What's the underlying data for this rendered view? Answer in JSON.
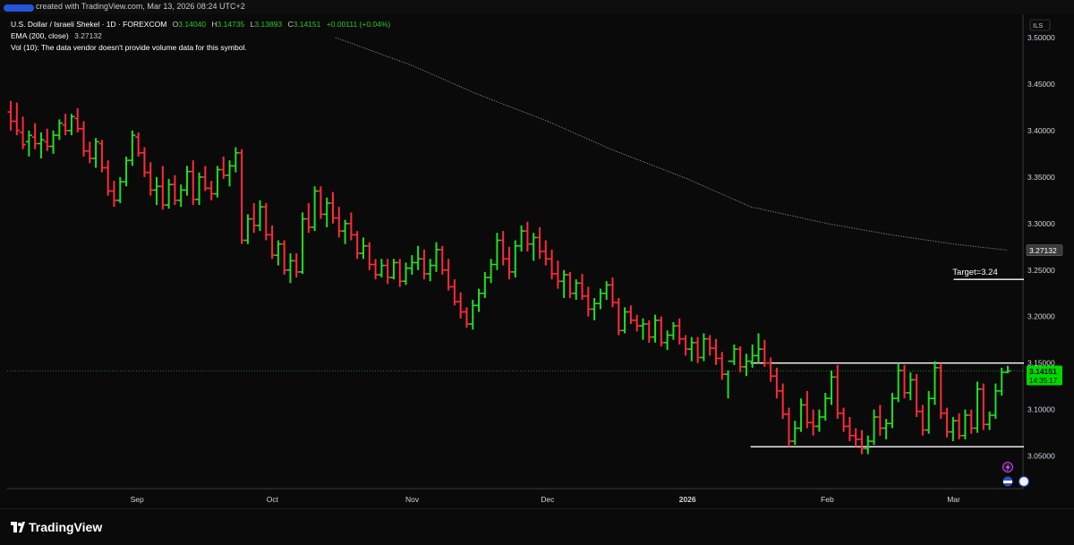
{
  "header": {
    "created_text": "created with TradingView.com, Mar 13, 2026 08:24 UTC+2"
  },
  "legend": {
    "symbol": "U.S. Dollar / Israeli Shekel · 1D · FOREXCOM",
    "o_label": "O",
    "o_value": "3.14040",
    "h_label": "H",
    "h_value": "3.14735",
    "l_label": "L",
    "l_value": "3.13893",
    "c_label": "C",
    "c_value": "3.14151",
    "change": "+0.00111 (+0.04%)",
    "ema_label": "EMA (200, close)",
    "ema_value": "3.27132",
    "vol_text": "Vol (10): The data vendor doesn't provide volume data for this symbol."
  },
  "axis": {
    "currency": "ILS",
    "ema_tag": "3.27132",
    "price_tag": "3.14151",
    "countdown_tag": "14:35:17"
  },
  "annotations": {
    "target_label": "Target=3.24"
  },
  "footer": {
    "brand": "TradingView"
  },
  "colors": {
    "up": "#22dd22",
    "down": "#ff2a3a",
    "ema": "#8a8a8a",
    "price_tag_bg": "#00d800",
    "background": "#0a0a0a"
  },
  "icons": [
    "lightning-icon",
    "us-flag-icon",
    "israel-flag-icon"
  ],
  "chart_data": {
    "type": "ohlc",
    "symbol": "USDILS",
    "ylim": [
      3.015,
      3.525
    ],
    "yticks": [
      "3.50000",
      "3.45000",
      "3.40000",
      "3.35000",
      "3.30000",
      "3.25000",
      "3.20000",
      "3.15000",
      "3.10000",
      "3.05000"
    ],
    "xticks": [
      {
        "label": "Sep",
        "date": "2025-09-01"
      },
      {
        "label": "Oct",
        "date": "2025-10-01"
      },
      {
        "label": "Nov",
        "date": "2025-11-01"
      },
      {
        "label": "Dec",
        "date": "2025-12-01"
      },
      {
        "label": "2026",
        "date": "2026-01-01"
      },
      {
        "label": "Feb",
        "date": "2026-02-01"
      },
      {
        "label": "Mar",
        "date": "2026-03-01"
      }
    ],
    "first_date": "2025-08-04",
    "last_date": "2026-03-13",
    "bars": [
      [
        3.42,
        3.432,
        3.4,
        3.41
      ],
      [
        3.41,
        3.43,
        3.395,
        3.4
      ],
      [
        3.398,
        3.415,
        3.38,
        3.385
      ],
      [
        3.388,
        3.4,
        3.372,
        3.395
      ],
      [
        3.393,
        3.408,
        3.38,
        3.386
      ],
      [
        3.386,
        3.398,
        3.37,
        3.39
      ],
      [
        3.388,
        3.402,
        3.378,
        3.383
      ],
      [
        3.383,
        3.4,
        3.375,
        3.395
      ],
      [
        3.395,
        3.412,
        3.39,
        3.408
      ],
      [
        3.406,
        3.418,
        3.395,
        3.4
      ],
      [
        3.4,
        3.418,
        3.395,
        3.415
      ],
      [
        3.413,
        3.424,
        3.398,
        3.402
      ],
      [
        3.402,
        3.41,
        3.372,
        3.378
      ],
      [
        3.378,
        3.388,
        3.365,
        3.37
      ],
      [
        3.37,
        3.392,
        3.36,
        3.388
      ],
      [
        3.386,
        3.39,
        3.355,
        3.36
      ],
      [
        3.36,
        3.368,
        3.33,
        3.335
      ],
      [
        3.335,
        3.346,
        3.318,
        3.325
      ],
      [
        3.325,
        3.35,
        3.322,
        3.345
      ],
      [
        3.345,
        3.372,
        3.34,
        3.368
      ],
      [
        3.368,
        3.4,
        3.362,
        3.395
      ],
      [
        3.393,
        3.398,
        3.372,
        3.376
      ],
      [
        3.376,
        3.382,
        3.35,
        3.355
      ],
      [
        3.355,
        3.366,
        3.33,
        3.336
      ],
      [
        3.336,
        3.35,
        3.32,
        3.34
      ],
      [
        3.34,
        3.362,
        3.315,
        3.32
      ],
      [
        3.32,
        3.348,
        3.316,
        3.342
      ],
      [
        3.342,
        3.352,
        3.32,
        3.325
      ],
      [
        3.325,
        3.342,
        3.318,
        3.336
      ],
      [
        3.336,
        3.362,
        3.33,
        3.356
      ],
      [
        3.356,
        3.368,
        3.32,
        3.326
      ],
      [
        3.326,
        3.355,
        3.32,
        3.35
      ],
      [
        3.35,
        3.362,
        3.335,
        3.338
      ],
      [
        3.338,
        3.346,
        3.325,
        3.332
      ],
      [
        3.332,
        3.362,
        3.328,
        3.358
      ],
      [
        3.358,
        3.372,
        3.348,
        3.352
      ],
      [
        3.352,
        3.368,
        3.34,
        3.362
      ],
      [
        3.362,
        3.382,
        3.355,
        3.376
      ],
      [
        3.376,
        3.38,
        3.278,
        3.282
      ],
      [
        3.282,
        3.31,
        3.278,
        3.305
      ],
      [
        3.305,
        3.322,
        3.29,
        3.298
      ],
      [
        3.298,
        3.325,
        3.292,
        3.318
      ],
      [
        3.318,
        3.322,
        3.282,
        3.288
      ],
      [
        3.288,
        3.298,
        3.262,
        3.266
      ],
      [
        3.266,
        3.282,
        3.255,
        3.278
      ],
      [
        3.278,
        3.282,
        3.245,
        3.25
      ],
      [
        3.25,
        3.268,
        3.236,
        3.26
      ],
      [
        3.26,
        3.268,
        3.242,
        3.248
      ],
      [
        3.248,
        3.312,
        3.246,
        3.305
      ],
      [
        3.305,
        3.322,
        3.29,
        3.296
      ],
      [
        3.296,
        3.34,
        3.292,
        3.335
      ],
      [
        3.335,
        3.34,
        3.305,
        3.31
      ],
      [
        3.31,
        3.328,
        3.296,
        3.322
      ],
      [
        3.322,
        3.334,
        3.3,
        3.306
      ],
      [
        3.306,
        3.318,
        3.285,
        3.292
      ],
      [
        3.292,
        3.304,
        3.278,
        3.3
      ],
      [
        3.3,
        3.312,
        3.282,
        3.288
      ],
      [
        3.288,
        3.292,
        3.262,
        3.268
      ],
      [
        3.268,
        3.285,
        3.262,
        3.276
      ],
      [
        3.276,
        3.28,
        3.25,
        3.256
      ],
      [
        3.256,
        3.262,
        3.24,
        3.245
      ],
      [
        3.245,
        3.262,
        3.242,
        3.255
      ],
      [
        3.255,
        3.262,
        3.235,
        3.242
      ],
      [
        3.242,
        3.262,
        3.24,
        3.258
      ],
      [
        3.258,
        3.262,
        3.232,
        3.238
      ],
      [
        3.238,
        3.258,
        3.234,
        3.252
      ],
      [
        3.252,
        3.266,
        3.245,
        3.258
      ],
      [
        3.258,
        3.276,
        3.25,
        3.262
      ],
      [
        3.262,
        3.272,
        3.24,
        3.246
      ],
      [
        3.246,
        3.262,
        3.238,
        3.255
      ],
      [
        3.255,
        3.28,
        3.248,
        3.272
      ],
      [
        3.272,
        3.276,
        3.245,
        3.25
      ],
      [
        3.25,
        3.262,
        3.228,
        3.232
      ],
      [
        3.232,
        3.24,
        3.212,
        3.216
      ],
      [
        3.216,
        3.226,
        3.198,
        3.205
      ],
      [
        3.205,
        3.21,
        3.188,
        3.192
      ],
      [
        3.192,
        3.218,
        3.186,
        3.212
      ],
      [
        3.212,
        3.23,
        3.205,
        3.225
      ],
      [
        3.225,
        3.248,
        3.22,
        3.242
      ],
      [
        3.242,
        3.262,
        3.236,
        3.256
      ],
      [
        3.256,
        3.29,
        3.25,
        3.282
      ],
      [
        3.282,
        3.292,
        3.255,
        3.262
      ],
      [
        3.262,
        3.275,
        3.24,
        3.248
      ],
      [
        3.248,
        3.282,
        3.242,
        3.276
      ],
      [
        3.276,
        3.298,
        3.27,
        3.292
      ],
      [
        3.292,
        3.302,
        3.27,
        3.278
      ],
      [
        3.278,
        3.29,
        3.26,
        3.285
      ],
      [
        3.285,
        3.296,
        3.262,
        3.27
      ],
      [
        3.27,
        3.282,
        3.255,
        3.262
      ],
      [
        3.262,
        3.272,
        3.24,
        3.246
      ],
      [
        3.246,
        3.26,
        3.23,
        3.238
      ],
      [
        3.238,
        3.25,
        3.22,
        3.245
      ],
      [
        3.245,
        3.248,
        3.22,
        3.225
      ],
      [
        3.225,
        3.24,
        3.218,
        3.236
      ],
      [
        3.236,
        3.246,
        3.218,
        3.222
      ],
      [
        3.222,
        3.232,
        3.2,
        3.208
      ],
      [
        3.208,
        3.22,
        3.196,
        3.214
      ],
      [
        3.214,
        3.23,
        3.208,
        3.225
      ],
      [
        3.225,
        3.238,
        3.218,
        3.234
      ],
      [
        3.234,
        3.242,
        3.21,
        3.215
      ],
      [
        3.215,
        3.22,
        3.18,
        3.185
      ],
      [
        3.185,
        3.21,
        3.182,
        3.205
      ],
      [
        3.205,
        3.212,
        3.192,
        3.196
      ],
      [
        3.196,
        3.202,
        3.184,
        3.19
      ],
      [
        3.19,
        3.198,
        3.175,
        3.192
      ],
      [
        3.192,
        3.196,
        3.172,
        3.178
      ],
      [
        3.178,
        3.202,
        3.172,
        3.196
      ],
      [
        3.196,
        3.2,
        3.168,
        3.172
      ],
      [
        3.172,
        3.185,
        3.164,
        3.18
      ],
      [
        3.18,
        3.194,
        3.175,
        3.19
      ],
      [
        3.19,
        3.198,
        3.17,
        3.176
      ],
      [
        3.176,
        3.18,
        3.158,
        3.165
      ],
      [
        3.165,
        3.178,
        3.152,
        3.172
      ],
      [
        3.172,
        3.178,
        3.15,
        3.156
      ],
      [
        3.156,
        3.182,
        3.152,
        3.176
      ],
      [
        3.176,
        3.18,
        3.158,
        3.166
      ],
      [
        3.166,
        3.176,
        3.148,
        3.155
      ],
      [
        3.155,
        3.162,
        3.132,
        3.138
      ],
      [
        3.138,
        3.142,
        3.112,
        3.152
      ],
      [
        3.152,
        3.17,
        3.148,
        3.165
      ],
      [
        3.165,
        3.168,
        3.14,
        3.146
      ],
      [
        3.146,
        3.16,
        3.136,
        3.152
      ],
      [
        3.152,
        3.17,
        3.145,
        3.158
      ],
      [
        3.158,
        3.182,
        3.15,
        3.165
      ],
      [
        3.165,
        3.175,
        3.146,
        3.15
      ],
      [
        3.15,
        3.156,
        3.13,
        3.136
      ],
      [
        3.136,
        3.145,
        3.112,
        3.12
      ],
      [
        3.12,
        3.128,
        3.09,
        3.095
      ],
      [
        3.095,
        3.102,
        3.06,
        3.066
      ],
      [
        3.066,
        3.088,
        3.062,
        3.08
      ],
      [
        3.08,
        3.112,
        3.076,
        3.105
      ],
      [
        3.105,
        3.12,
        3.08,
        3.086
      ],
      [
        3.086,
        3.1,
        3.072,
        3.082
      ],
      [
        3.082,
        3.1,
        3.076,
        3.092
      ],
      [
        3.092,
        3.118,
        3.088,
        3.112
      ],
      [
        3.112,
        3.142,
        3.105,
        3.135
      ],
      [
        3.135,
        3.148,
        3.09,
        3.096
      ],
      [
        3.096,
        3.102,
        3.076,
        3.082
      ],
      [
        3.082,
        3.092,
        3.066,
        3.072
      ],
      [
        3.072,
        3.08,
        3.06,
        3.068
      ],
      [
        3.068,
        3.078,
        3.052,
        3.058
      ],
      [
        3.058,
        3.072,
        3.052,
        3.066
      ],
      [
        3.066,
        3.1,
        3.062,
        3.092
      ],
      [
        3.092,
        3.105,
        3.072,
        3.08
      ],
      [
        3.08,
        3.09,
        3.068,
        3.085
      ],
      [
        3.085,
        3.118,
        3.08,
        3.112
      ],
      [
        3.112,
        3.15,
        3.108,
        3.142
      ],
      [
        3.142,
        3.148,
        3.112,
        3.118
      ],
      [
        3.118,
        3.14,
        3.11,
        3.132
      ],
      [
        3.132,
        3.138,
        3.092,
        3.098
      ],
      [
        3.098,
        3.105,
        3.072,
        3.078
      ],
      [
        3.078,
        3.12,
        3.074,
        3.112
      ],
      [
        3.112,
        3.152,
        3.105,
        3.145
      ],
      [
        3.145,
        3.15,
        3.09,
        3.096
      ],
      [
        3.096,
        3.102,
        3.07,
        3.076
      ],
      [
        3.076,
        3.092,
        3.066,
        3.088
      ],
      [
        3.088,
        3.096,
        3.068,
        3.072
      ],
      [
        3.072,
        3.1,
        3.068,
        3.094
      ],
      [
        3.094,
        3.1,
        3.074,
        3.08
      ],
      [
        3.08,
        3.13,
        3.075,
        3.122
      ],
      [
        3.122,
        3.128,
        3.078,
        3.084
      ],
      [
        3.084,
        3.098,
        3.078,
        3.094
      ],
      [
        3.094,
        3.128,
        3.09,
        3.12
      ],
      [
        3.12,
        3.145,
        3.115,
        3.14
      ],
      [
        3.14,
        3.147,
        3.139,
        3.1415
      ]
    ],
    "ema200": {
      "name": "EMA (200, close)",
      "points": [
        {
          "date": "2025-10-15",
          "value": 3.5
        },
        {
          "date": "2025-11-01",
          "value": 3.47
        },
        {
          "date": "2025-11-15",
          "value": 3.44
        },
        {
          "date": "2025-12-01",
          "value": 3.41
        },
        {
          "date": "2025-12-15",
          "value": 3.38
        },
        {
          "date": "2026-01-01",
          "value": 3.348
        },
        {
          "date": "2026-01-15",
          "value": 3.318
        },
        {
          "date": "2026-02-01",
          "value": 3.3
        },
        {
          "date": "2026-02-15",
          "value": 3.288
        },
        {
          "date": "2026-03-01",
          "value": 3.278
        },
        {
          "date": "2026-03-13",
          "value": 3.2713
        }
      ]
    },
    "current_price": 3.14151,
    "levels": [
      {
        "name": "target",
        "value": 3.24,
        "from": "2026-03-01",
        "to": "2026-03-13"
      },
      {
        "name": "range-top",
        "value": 3.15,
        "from": "2026-01-15",
        "to": "2026-03-13"
      },
      {
        "name": "range-bottom",
        "value": 3.06,
        "from": "2026-01-15",
        "to": "2026-03-13"
      }
    ]
  }
}
